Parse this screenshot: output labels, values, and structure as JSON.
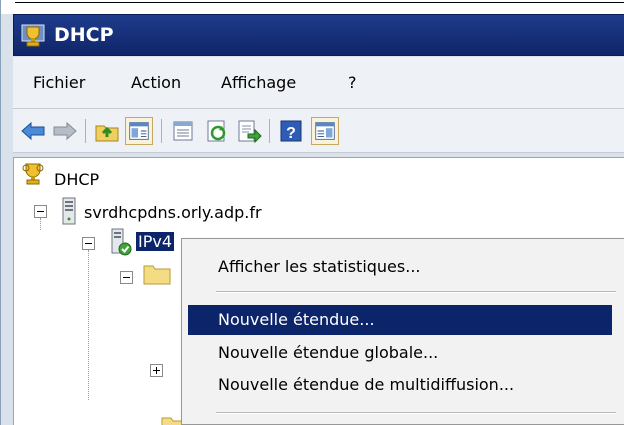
{
  "window": {
    "title": "DHCP"
  },
  "menu": {
    "items": [
      "Fichier",
      "Action",
      "Affichage",
      "?"
    ]
  },
  "toolbar": {
    "buttons": [
      "back-icon",
      "forward-icon",
      "up-folder-icon",
      "show-hide-console-tree-icon",
      "properties-icon",
      "refresh-icon",
      "export-list-icon",
      "help-icon",
      "show-hide-action-pane-icon"
    ]
  },
  "tree": {
    "root": "DHCP",
    "server": "svrdhcpdns.orly.adp.fr",
    "ipv4": "IPv4"
  },
  "context_menu": {
    "items": [
      "Afficher les statistiques...",
      "Nouvelle étendue...",
      "Nouvelle étendue globale...",
      "Nouvelle étendue de multidiffusion..."
    ],
    "highlighted": "Nouvelle étendue..."
  },
  "colors": {
    "title_bar": "#1f3c8c",
    "selection": "#0b246a"
  }
}
